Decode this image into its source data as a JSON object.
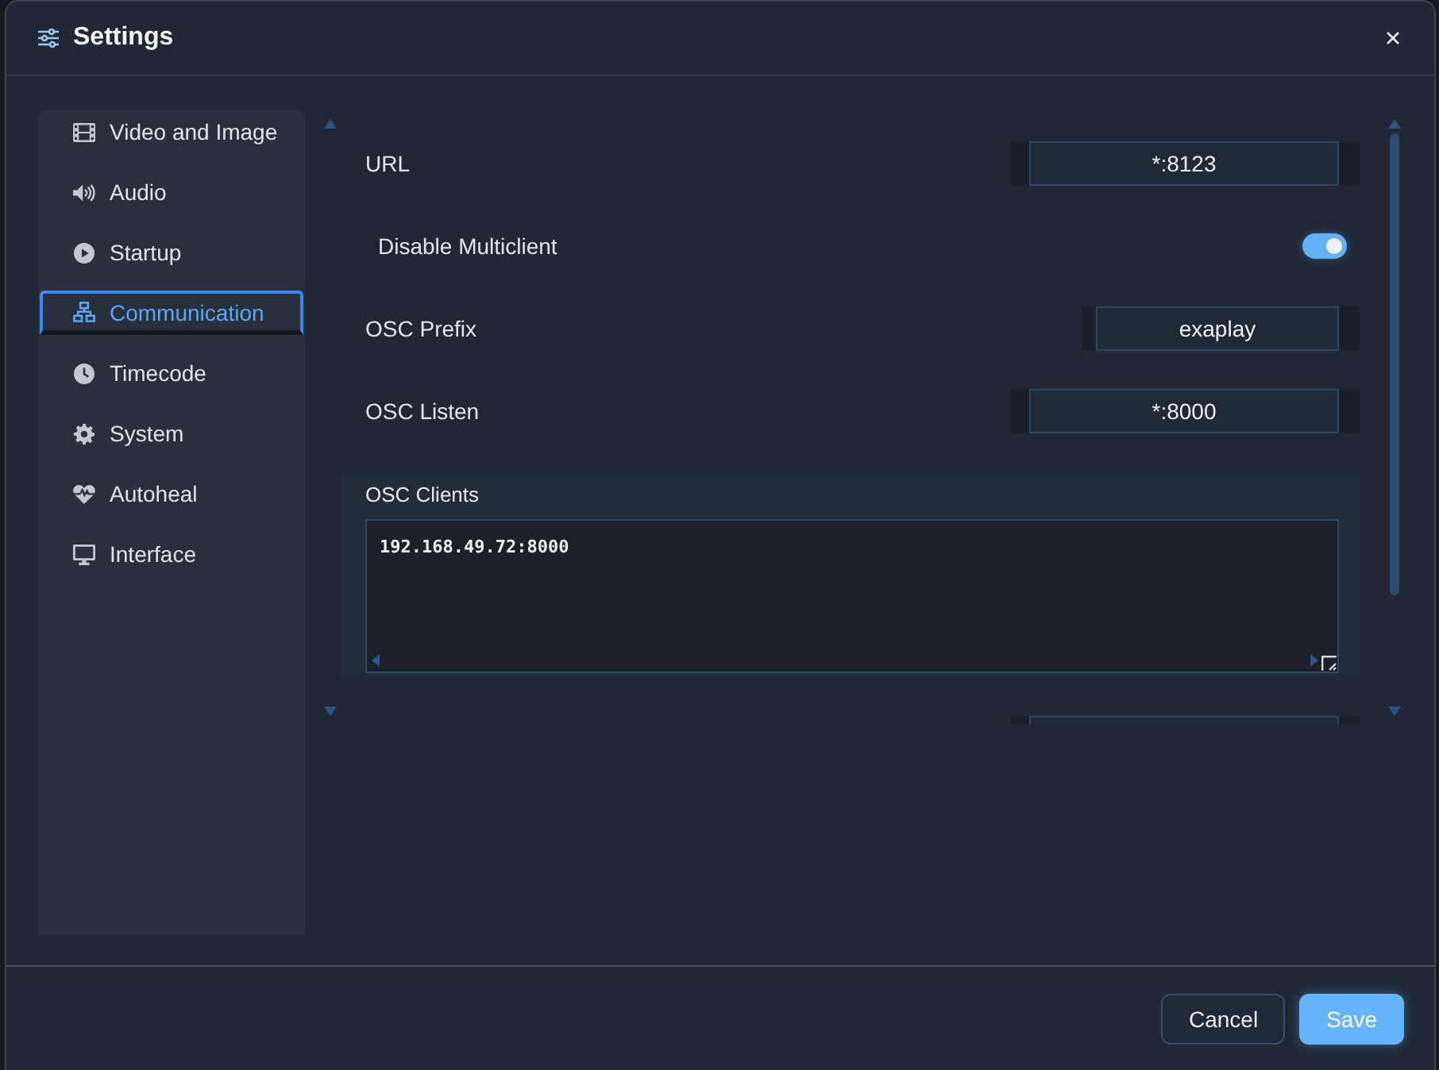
{
  "window": {
    "title": "Settings"
  },
  "sidebar": {
    "items": [
      {
        "label": "Video and Image",
        "selected": false
      },
      {
        "label": "Audio",
        "selected": false
      },
      {
        "label": "Startup",
        "selected": false
      },
      {
        "label": "Communication",
        "selected": true
      },
      {
        "label": "Timecode",
        "selected": false
      },
      {
        "label": "System",
        "selected": false
      },
      {
        "label": "Autoheal",
        "selected": false
      },
      {
        "label": "Interface",
        "selected": false
      }
    ]
  },
  "settings": {
    "rows": [
      {
        "kind": "input",
        "label": "URL",
        "value": "*:8123"
      },
      {
        "kind": "toggle",
        "label": "Disable Multiclient",
        "on": true
      },
      {
        "kind": "input",
        "label": "OSC Prefix",
        "value": "exaplay"
      },
      {
        "kind": "input",
        "label": "OSC Listen",
        "value": "*:8000"
      },
      {
        "kind": "textarea",
        "label": "OSC Clients",
        "value": "192.168.49.72:8000"
      },
      {
        "kind": "input"
      }
    ]
  },
  "footer": {
    "buttons": [
      {
        "label": "Cancel",
        "kind": "secondary"
      },
      {
        "label": "Save",
        "kind": "primary"
      }
    ]
  }
}
